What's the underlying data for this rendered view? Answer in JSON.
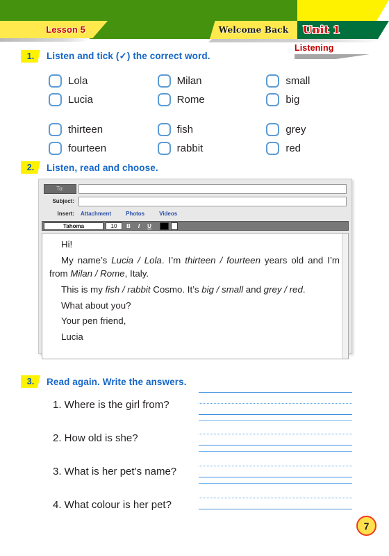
{
  "header": {
    "lesson_tab": "Lesson 5",
    "welcome_tab": "Welcome Back",
    "unit_tab": "Unit 1",
    "skill_label": "Listening",
    "colors": {
      "green": "#45920f",
      "dark_green": "#00703c",
      "yellow": "#fff200",
      "tab_yellow": "#ffe94d",
      "red_text": "#c00000",
      "blue_text": "#1567c8"
    }
  },
  "exercise1": {
    "number": "1.",
    "title": "Listen and tick (✓) the correct word.",
    "rows": [
      [
        {
          "label": "Lola",
          "checked": false
        },
        {
          "label": "Milan",
          "checked": false
        },
        {
          "label": "small",
          "checked": false
        }
      ],
      [
        {
          "label": "Lucia",
          "checked": false
        },
        {
          "label": "Rome",
          "checked": false
        },
        {
          "label": "big",
          "checked": false
        }
      ],
      [
        {
          "label": "thirteen",
          "checked": false
        },
        {
          "label": "fish",
          "checked": false
        },
        {
          "label": "grey",
          "checked": false
        }
      ],
      [
        {
          "label": "fourteen",
          "checked": false
        },
        {
          "label": "rabbit",
          "checked": false
        },
        {
          "label": "red",
          "checked": false
        }
      ]
    ]
  },
  "exercise2": {
    "number": "2.",
    "title": "Listen, read and choose.",
    "mail": {
      "to_label": "To:",
      "to_value": "",
      "subject_label": "Subject:",
      "subject_value": "",
      "insert_label": "Insert:",
      "insert_links": [
        "Attachment",
        "Photos",
        "Videos"
      ],
      "font_name": "Tahoma",
      "font_size": "10",
      "bold_label": "B",
      "italic_label": "I",
      "underline_label": "U",
      "color_swatch": "#000000",
      "body": {
        "greeting": "Hi!",
        "para1_a": "My name’s ",
        "para1_choice1": "Lucia / Lola",
        "para1_b": ". I’m ",
        "para1_choice2": "thirteen / fourteen",
        "para1_c": " years old and I’m from ",
        "para1_choice3": "Milan / Rome",
        "para1_d": ", Italy.",
        "para2_a": "This is my ",
        "para2_choice1": "fish / rabbit",
        "para2_b": " Cosmo. It’s ",
        "para2_choice2": "big / small",
        "para2_c": " and ",
        "para2_choice3": "grey / red",
        "para2_d": ".",
        "line_what": "What about you?",
        "line_signoff": "Your pen friend,",
        "line_name": "Lucia"
      }
    }
  },
  "exercise3": {
    "number": "3.",
    "title": "Read again. Write the answers.",
    "questions": [
      {
        "text": "1. Where is the girl from?",
        "answer": ""
      },
      {
        "text": "2. How old is she?",
        "answer": ""
      },
      {
        "text": "3. What is her pet’s name?",
        "answer": ""
      },
      {
        "text": "4. What colour is her pet?",
        "answer": ""
      }
    ]
  },
  "footer": {
    "page_number": "7"
  }
}
